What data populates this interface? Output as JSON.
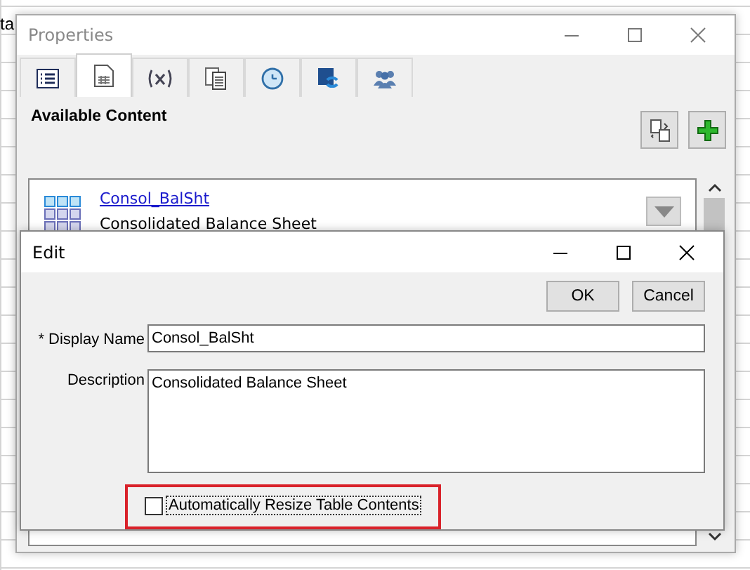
{
  "background_sheet": {
    "cell_text": "ta"
  },
  "properties_window": {
    "title": "Properties",
    "tabs": [
      {
        "kind": "list",
        "selected": false
      },
      {
        "kind": "document",
        "selected": true
      },
      {
        "kind": "variable",
        "selected": false
      },
      {
        "kind": "pages",
        "selected": false
      },
      {
        "kind": "clock",
        "selected": false
      },
      {
        "kind": "refresh",
        "selected": false
      },
      {
        "kind": "users",
        "selected": false
      }
    ],
    "section_title": "Available Content",
    "content_item": {
      "name": "Consol_BalSht",
      "description": "Consolidated Balance Sheet"
    }
  },
  "edit_dialog": {
    "title": "Edit",
    "buttons": [
      "OK",
      "Cancel"
    ],
    "display_name": {
      "label": "* Display Name",
      "value": "Consol_BalSht"
    },
    "description": {
      "label": "Description",
      "value": "Consolidated Balance Sheet"
    },
    "auto_resize": {
      "label": "Automatically Resize Table Contents",
      "checked": false,
      "highlighted": true
    }
  }
}
